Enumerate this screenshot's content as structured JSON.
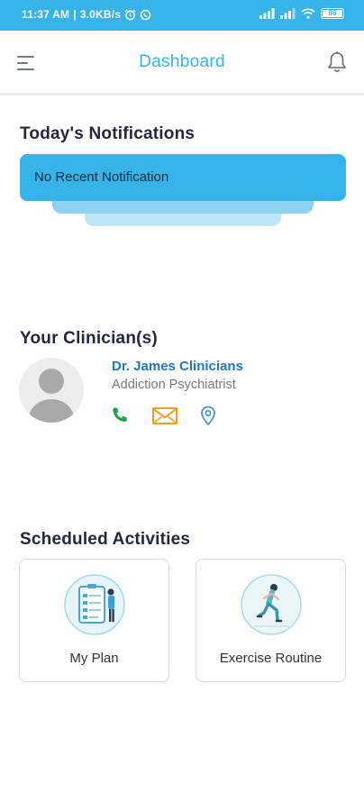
{
  "status_bar": {
    "time": "11:37 AM",
    "separator": "|",
    "net_speed": "3.0KB/s",
    "battery_level": "86"
  },
  "header": {
    "title": "Dashboard",
    "menu_icon": "hamburger-menu-icon",
    "bell_icon": "bell-icon"
  },
  "notifications": {
    "section_title": "Today's Notifications",
    "empty_message": "No Recent Notification"
  },
  "clinicians": {
    "section_title": "Your Clinician(s)",
    "items": [
      {
        "name": "Dr. James Clinicians",
        "role": "Addiction Psychiatrist",
        "actions": [
          "phone-icon",
          "mail-icon",
          "location-pin-icon"
        ]
      }
    ]
  },
  "activities": {
    "section_title": "Scheduled Activities",
    "items": [
      {
        "label": "My Plan",
        "icon": "plan-clipboard-illustration"
      },
      {
        "label": "Exercise Routine",
        "icon": "runner-illustration"
      }
    ]
  },
  "colors": {
    "primary": "#36b4ea",
    "title_dark": "#23283f",
    "clinician_name": "#2176c7",
    "phone_green": "#1fa34a",
    "mail_orange": "#f0a020",
    "location_blue": "#4a8fd8"
  }
}
